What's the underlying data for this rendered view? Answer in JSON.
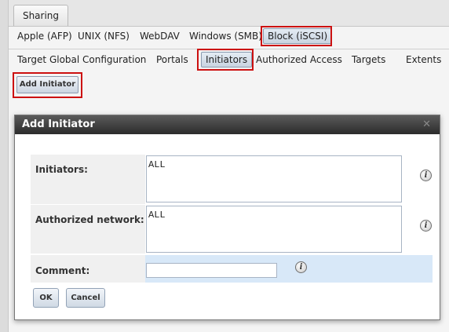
{
  "top_tab": {
    "label": "Sharing"
  },
  "share_types": [
    {
      "label": "Apple (AFP)"
    },
    {
      "label": "UNIX (NFS)"
    },
    {
      "label": "WebDAV"
    },
    {
      "label": "Windows (SMB)"
    },
    {
      "label": "Block (iSCSI)",
      "active": true
    }
  ],
  "iscsi_tabs": [
    {
      "label": "Target Global Configuration"
    },
    {
      "label": "Portals"
    },
    {
      "label": "Initiators",
      "active": true
    },
    {
      "label": "Authorized Access"
    },
    {
      "label": "Targets"
    },
    {
      "label": "Extents"
    }
  ],
  "add_button": {
    "label": "Add Initiator"
  },
  "dialog": {
    "title": "Add Initiator",
    "close_glyph": "✕",
    "fields": {
      "initiators": {
        "label": "Initiators:",
        "value": "ALL"
      },
      "auth_network": {
        "label": "Authorized network:",
        "value": "ALL"
      },
      "comment": {
        "label": "Comment:",
        "value": ""
      }
    },
    "info_glyph": "i",
    "ok_label": "OK",
    "cancel_label": "Cancel"
  },
  "colors": {
    "highlight_box": "#cc1111",
    "title_bar": "#2c2c2c",
    "row_highlight": "#d8e8f8"
  }
}
